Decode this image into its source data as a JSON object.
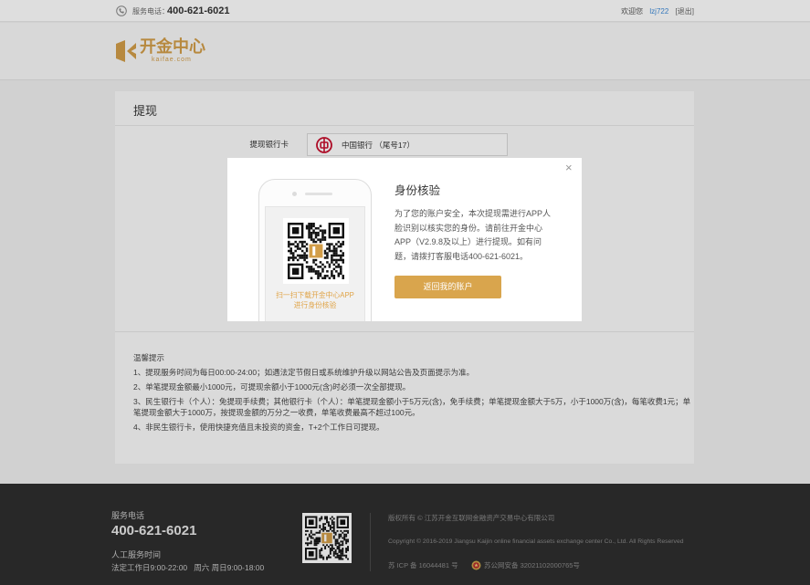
{
  "topbar": {
    "phone_label": "服务电话：",
    "phone_number": "400-621-6021",
    "welcome": "欢迎您",
    "username": "lzj722",
    "logout": "[退出]"
  },
  "header": {
    "logo_name": "开金中心",
    "logo_domain": "kaifae.com"
  },
  "withdraw": {
    "title": "提现",
    "bank_card_label": "提现银行卡",
    "bank_name": "中国银行",
    "bank_tail": "（尾号17）"
  },
  "tips": {
    "title": "温馨提示",
    "items": [
      "1、提现服务时间为每日00:00-24:00；如遇法定节假日或系统维护升级以网站公告及页面提示为准。",
      "2、单笔提现金额最小1000元，可提现余额小于1000元(含)时必须一次全部提现。",
      "3、民生银行卡（个人）：免提现手续费；其他银行卡（个人）：单笔提现金额小于5万元(含)，免手续费；单笔提现金额大于5万，小于1000万(含)，每笔收费1元；单笔提现金额大于1000万，按提现金额的万分之一收费，单笔收费最高不超过100元。",
      "4、非民生银行卡，使用快捷充值且未投资的资金，T+2个工作日可提现。"
    ]
  },
  "modal": {
    "title": "身份核验",
    "description": "为了您的账户安全，本次提现需进行APP人脸识别以核实您的身份。请前往开金中心APP（V2.9.8及以上）进行提现。如有问题，请拨打客服电话400-621-6021。",
    "qr_caption_line1": "扫一扫下载开金中心APP",
    "qr_caption_line2": "进行身份核验",
    "button_label": "返回我的账户",
    "close_glyph": "×"
  },
  "footer": {
    "service_phone_label": "服务电话",
    "service_phone": "400-621-6021",
    "hours_label": "人工服务时间",
    "hours": "法定工作日9:00-22:00   周六 周日9:00-18:00",
    "copyright_cn": "版权所有 © 江苏开金互联网金融资产交易中心有限公司",
    "copyright_en": "Copyright © 2016-2019 Jiangsu Kaijin online financial assets exchange center Co., Ltd. All Rights Reserved",
    "icp": "苏 ICP 备 16044481 号",
    "police": "苏公网安备 32021102000765号"
  },
  "colors": {
    "brand_gold": "#d39e49",
    "button_gold": "#d9a54d",
    "link_blue": "#3d8ad8",
    "boc_red": "#c8102e",
    "footer_bg": "#2e2e2e"
  },
  "icons": {
    "topbar_phone": "phone-icon",
    "logo": "logo-mark-icon",
    "bank": "boc-logo-icon",
    "app_qr": "qr-code-icon",
    "footer_qr": "qr-code-icon",
    "close": "close-icon",
    "police": "police-badge-icon"
  }
}
